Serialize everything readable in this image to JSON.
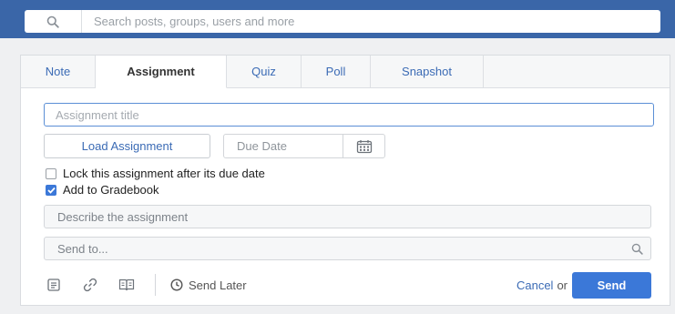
{
  "search": {
    "placeholder": "Search posts, groups, users and more",
    "icon": "search-icon"
  },
  "tabs": [
    {
      "label": "Note"
    },
    {
      "label": "Assignment"
    },
    {
      "label": "Quiz"
    },
    {
      "label": "Poll"
    },
    {
      "label": "Snapshot"
    }
  ],
  "form": {
    "title_placeholder": "Assignment title",
    "load_label": "Load Assignment",
    "due_placeholder": "Due Date",
    "lock_label": "Lock this assignment after its due date",
    "gradebook_label": "Add to Gradebook",
    "describe_placeholder": "Describe the assignment",
    "send_to_placeholder": "Send to..."
  },
  "toolbar": {
    "send_later_label": "Send Later",
    "cancel_label": "Cancel",
    "or_label": "or",
    "send_label": "Send"
  },
  "colors": {
    "topbar": "#3a66a8",
    "accent": "#3b78d8",
    "link": "#3b6bb5"
  }
}
